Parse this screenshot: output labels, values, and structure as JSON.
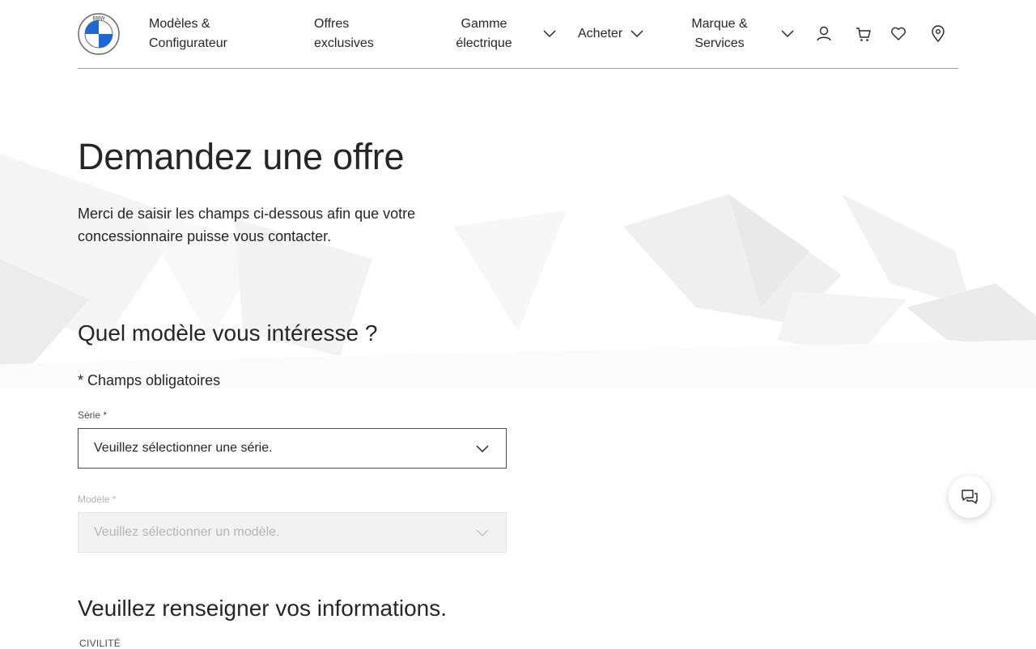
{
  "header": {
    "nav": [
      {
        "line1": "Modèles &",
        "line2": "Configurateur"
      },
      {
        "line1": "Offres",
        "line2": "exclusives"
      },
      {
        "line1": "Gamme",
        "line2": "électrique"
      },
      {
        "line1": "Acheter"
      },
      {
        "line1": "Marque &",
        "line2": "Services"
      }
    ],
    "logo_letters": "BMW",
    "icons": [
      "user-icon",
      "cart-icon",
      "heart-icon",
      "location-pin-icon"
    ]
  },
  "main": {
    "title": "Demandez une offre",
    "intro_line1": "Merci de saisir les champs ci-dessous afin que votre",
    "intro_line2": "concessionnaire puisse vous contacter.",
    "section1_title": "Quel modèle vous intéresse ?",
    "required_note": "* Champs obligatoires",
    "serie": {
      "label": "Série *",
      "value": "Veuillez sélectionner une série."
    },
    "modele": {
      "label": "Modèle *",
      "value": "Veuillez sélectionner un modèle."
    },
    "section2_title": "Veuillez renseigner vos informations.",
    "civilite_label": "CIVILITÉ"
  },
  "chat": {
    "icon": "chat-icon"
  },
  "colors": {
    "bmw_blue": "#1c69d4",
    "text": "#262626",
    "divider": "#9d9d9d"
  }
}
